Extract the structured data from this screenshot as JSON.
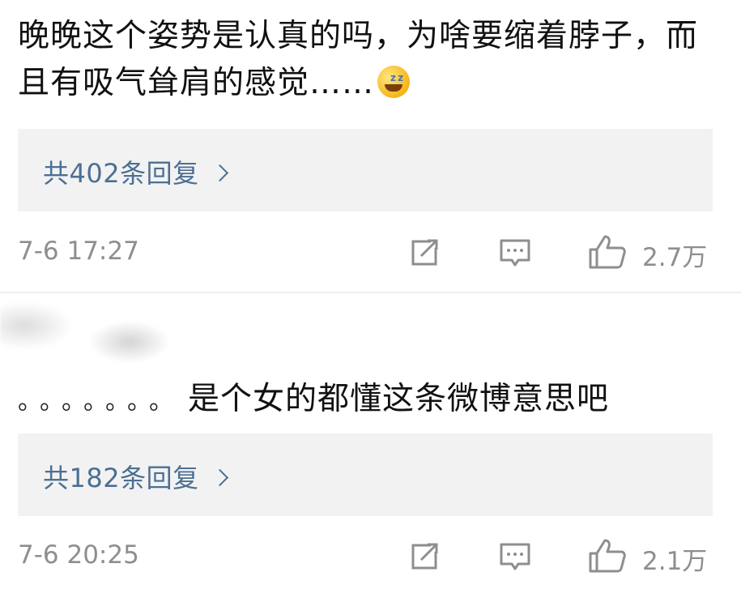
{
  "comments": [
    {
      "text": "晚晚这个姿势是认真的吗，为啥要缩着脖子，而且有吸气耸肩的感觉……",
      "emoji": "sweat-smile-emoji",
      "reply_link": "共402条回复",
      "time": "7-6 17:27",
      "likes": "2.7万"
    },
    {
      "prefix": "。。。。。。。",
      "text": "是个女的都懂这条微博意思吧",
      "reply_link": "共182条回复",
      "time": "7-6 20:25",
      "likes": "2.1万"
    }
  ],
  "colors": {
    "text": "#111111",
    "link": "#4c6f93",
    "meta": "#8e8e8e",
    "reply_bg": "#f2f2f2"
  },
  "icons": [
    "share-icon",
    "comment-icon",
    "like-icon",
    "chevron-right-icon"
  ]
}
